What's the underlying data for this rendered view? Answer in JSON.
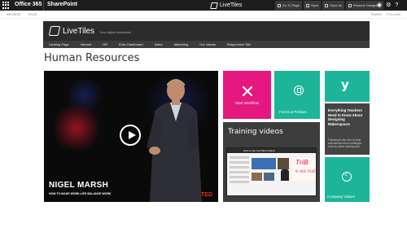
{
  "suite_bar": {
    "office_label": "Office 365",
    "sharepoint_label": "SharePoint",
    "brand": "LiveTiles",
    "actions": [
      "Go To Page",
      "Save",
      "Save As",
      "Resume Designing"
    ]
  },
  "ribbon": {
    "left": [
      "BROWSE",
      "PAGE"
    ],
    "right": [
      "SHARE",
      "FOLLOW"
    ]
  },
  "site_header": {
    "brand": "LiveTiles",
    "tagline": "Your digital workplace",
    "nav": [
      "Landing Page",
      "Intranet",
      "HR",
      "Exec Dashboard",
      "Sales",
      "Marketing",
      "Our Values",
      "Responsive Site"
    ]
  },
  "page": {
    "title": "Human Resources"
  },
  "video": {
    "speaker": "NIGEL MARSH",
    "talk": "HOW TO MAKE WORK-LIFE BALANCE WORK",
    "brand": "TED"
  },
  "tiles": {
    "workflow": "Start Workflow",
    "forms": "Forms & Policies",
    "article_title": "Everything Teachers Need to Know About Designing Makerspaces",
    "article_body": "Following in the vein of other educational reform strategies such as active learning and",
    "training_title": "Training videos",
    "training_bar": "How to use LiveTiles Intranet",
    "thumb_trib": "TriB",
    "thumb_mat": "e wa mat",
    "company": "Company Values"
  },
  "colors": {
    "magenta": "#e6177e",
    "teal": "#1cb59a",
    "dark": "#2b2b2b"
  }
}
